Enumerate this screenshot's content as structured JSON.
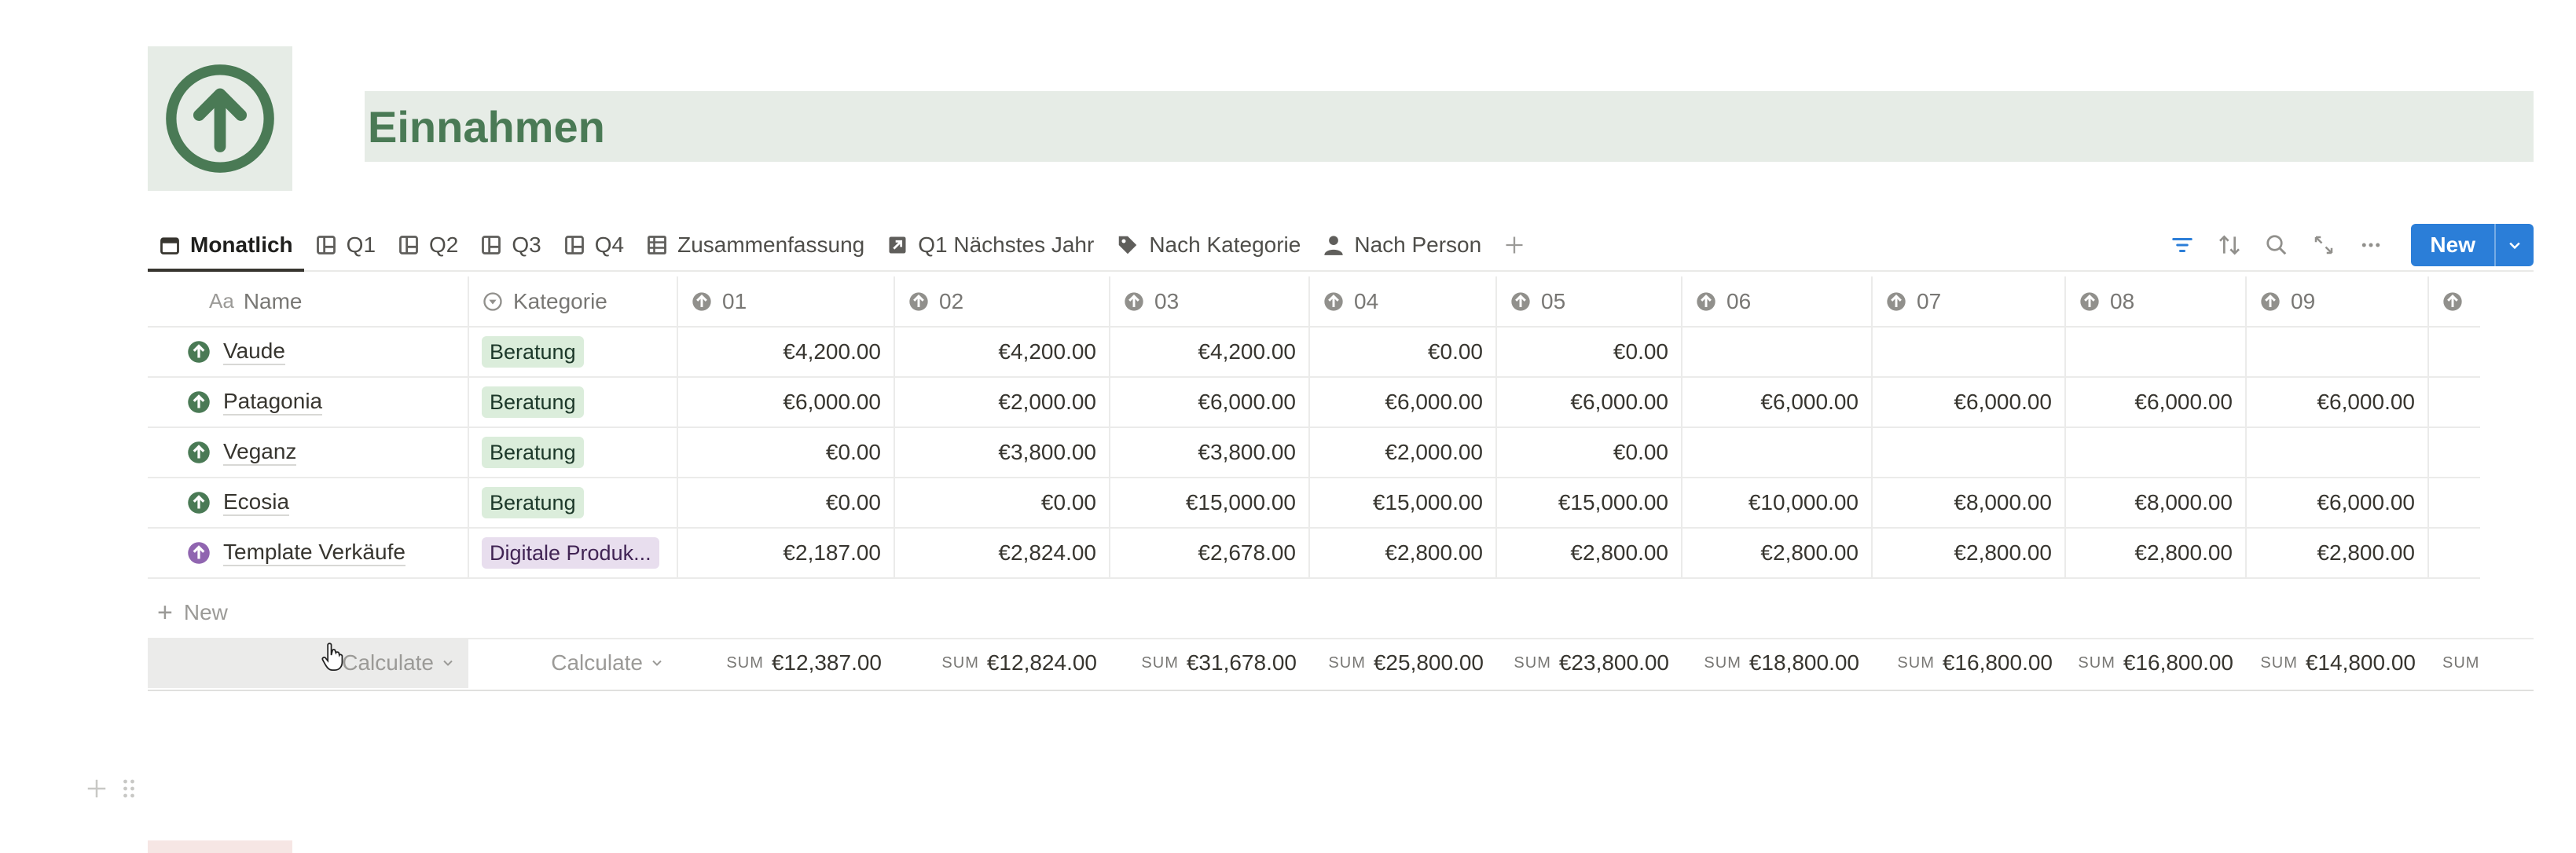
{
  "page": {
    "title": "Einnahmen",
    "icon": "arrow-up-circle-icon",
    "accent_color": "#4a7a55",
    "icon_bg": "#e6ece6"
  },
  "views": [
    {
      "label": "Monatlich",
      "icon": "calendar-icon",
      "active": true
    },
    {
      "label": "Q1",
      "icon": "board-icon"
    },
    {
      "label": "Q2",
      "icon": "board-icon"
    },
    {
      "label": "Q3",
      "icon": "board-icon"
    },
    {
      "label": "Q4",
      "icon": "board-icon"
    },
    {
      "label": "Zusammenfassung",
      "icon": "table-icon"
    },
    {
      "label": "Q1 Nächstes Jahr",
      "icon": "arrow-link-icon"
    },
    {
      "label": "Nach Kategorie",
      "icon": "tag-icon"
    },
    {
      "label": "Nach Person",
      "icon": "person-icon"
    }
  ],
  "toolbar": {
    "new_label": "New",
    "icons": [
      "filter-icon",
      "sort-icon",
      "search-icon",
      "expand-icon",
      "more-icon"
    ],
    "new_color": "#2b7ed8"
  },
  "table": {
    "columns": [
      {
        "label": "Name",
        "prefix": "Aa"
      },
      {
        "label": "Kategorie"
      },
      {
        "label": "01"
      },
      {
        "label": "02"
      },
      {
        "label": "03"
      },
      {
        "label": "04"
      },
      {
        "label": "05"
      },
      {
        "label": "06"
      },
      {
        "label": "07"
      },
      {
        "label": "08"
      },
      {
        "label": "09"
      },
      {
        "label": ""
      }
    ],
    "rows": [
      {
        "name": "Vaude",
        "icon_color": "#4a7a55",
        "category": "Beratung",
        "tag": "green",
        "values": [
          "€4,200.00",
          "€4,200.00",
          "€4,200.00",
          "€0.00",
          "€0.00",
          "",
          "",
          "",
          "",
          ""
        ]
      },
      {
        "name": "Patagonia",
        "icon_color": "#4a7a55",
        "category": "Beratung",
        "tag": "green",
        "values": [
          "€6,000.00",
          "€2,000.00",
          "€6,000.00",
          "€6,000.00",
          "€6,000.00",
          "€6,000.00",
          "€6,000.00",
          "€6,000.00",
          "€6,000.00",
          ""
        ]
      },
      {
        "name": "Veganz",
        "icon_color": "#4a7a55",
        "category": "Beratung",
        "tag": "green",
        "values": [
          "€0.00",
          "€3,800.00",
          "€3,800.00",
          "€2,000.00",
          "€0.00",
          "",
          "",
          "",
          "",
          ""
        ]
      },
      {
        "name": "Ecosia",
        "icon_color": "#4a7a55",
        "category": "Beratung",
        "tag": "green",
        "values": [
          "€0.00",
          "€0.00",
          "€15,000.00",
          "€15,000.00",
          "€15,000.00",
          "€10,000.00",
          "€8,000.00",
          "€8,000.00",
          "€6,000.00",
          ""
        ]
      },
      {
        "name": "Template Verkäufe",
        "icon_color": "#9065b0",
        "category": "Digitale Produk...",
        "tag": "purple",
        "values": [
          "€2,187.00",
          "€2,824.00",
          "€2,678.00",
          "€2,800.00",
          "€2,800.00",
          "€2,800.00",
          "€2,800.00",
          "€2,800.00",
          "€2,800.00",
          ""
        ]
      }
    ],
    "new_row_label": "New",
    "calculate_label": "Calculate",
    "sum_label": "SUM",
    "sums": [
      "€12,387.00",
      "€12,824.00",
      "€31,678.00",
      "€25,800.00",
      "€23,800.00",
      "€18,800.00",
      "€16,800.00",
      "€16,800.00",
      "€14,800.00"
    ]
  }
}
